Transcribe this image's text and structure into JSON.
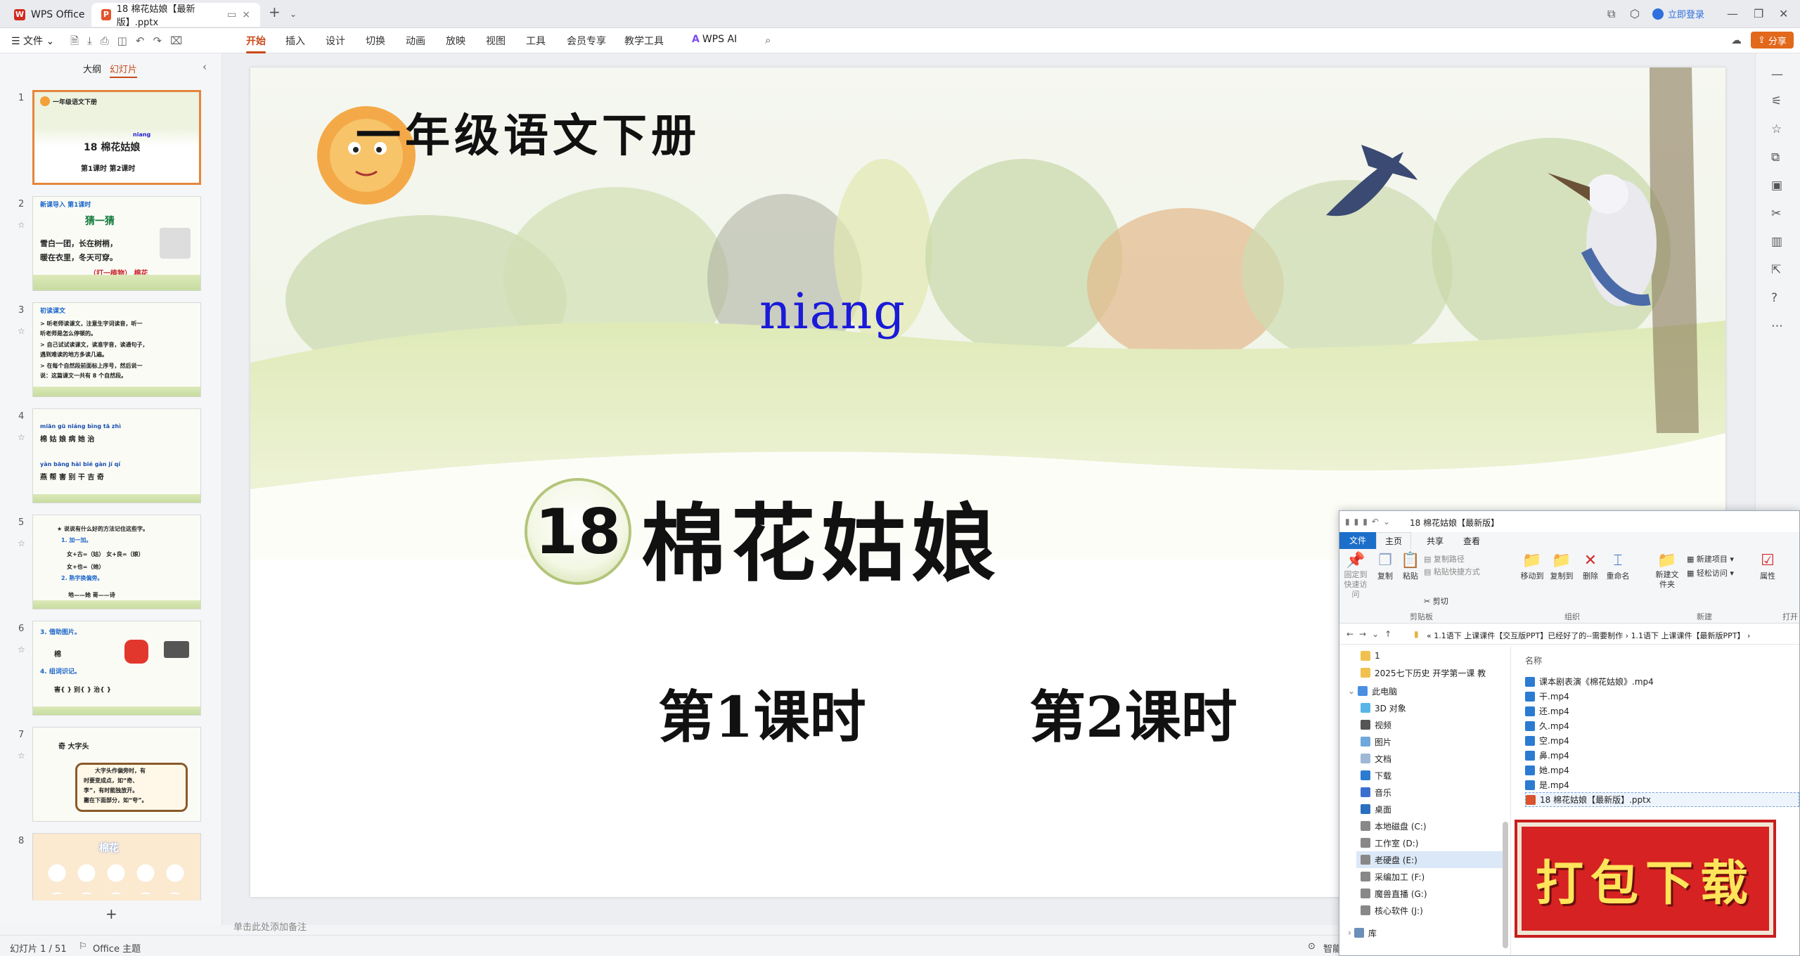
{
  "app": {
    "brand": "WPS Office",
    "doc_tab": "18 棉花姑娘【最新版】.pptx",
    "new_tab_symbol": "+",
    "login": "立即登录",
    "share": "分享"
  },
  "ribbon": {
    "file_menu": "文件",
    "tabs": [
      "开始",
      "插入",
      "设计",
      "切换",
      "动画",
      "放映",
      "视图",
      "工具",
      "会员专享",
      "教学工具"
    ],
    "wps_ai": "WPS AI"
  },
  "left_panel": {
    "outline_tab": "大纲",
    "slides_tab": "幻灯片",
    "add_slide": "+"
  },
  "thumbnails": [
    {
      "num": "1",
      "lines": [
        "一年级语文下册",
        "niang",
        "18 棉花姑娘",
        "第1课时    第2课时"
      ]
    },
    {
      "num": "2",
      "lines": [
        "新课导入        第1课时",
        "猜一猜",
        "雪白一团，长在树梢，",
        "暖在衣里，冬天可穿。",
        "（打一植物）   棉花"
      ]
    },
    {
      "num": "3",
      "lines": [
        "初读课文",
        "> 听老师读课文，注意生字词读音，听一",
        "  听老师是怎么停顿的。",
        "> 自己试试读课文，读准字音，读通句子，",
        "  遇到难读的地方多读几遍。",
        "> 在每个自然段前面标上序号，然后说一",
        "  说：这篇课文一共有 8 个自然段。"
      ]
    },
    {
      "num": "4",
      "lines": [
        "miān  gū  niáng  bìng  tā  zhì",
        "棉  姑  娘  病  她  治",
        "yàn  bāng  hài  bié  gàn  jí  qí",
        "燕  帮  害  别  干  吉  奇"
      ]
    },
    {
      "num": "5",
      "lines": [
        "★ 说说有什么好的方法记住这些字。",
        "1. 加一加。",
        "女+古=（姑）  女+良=（娘）",
        "女+也=（她）",
        "2. 熟字换偏旁。",
        "地——她   哥——诗"
      ]
    },
    {
      "num": "6",
      "lines": [
        "3. 借助图片。",
        "棉",
        "4. 组词识记。",
        "害{    } 别{    } 治{    }"
      ]
    },
    {
      "num": "7",
      "lines": [
        "奇   大字头",
        "大字头作偏旁时，有",
        "时要变成点，如“奇、",
        "李”，有时能独放开。",
        "撇在下面部分，如“夸”。"
      ]
    },
    {
      "num": "8",
      "lines": [
        "棉花"
      ]
    }
  ],
  "slide": {
    "header": "一年级语文下册",
    "lesson_number": "18",
    "pinyin": "niang",
    "title": "棉花姑娘",
    "period1": "第1课时",
    "period2": "第2课时"
  },
  "notes_placeholder": "单击此处添加备注",
  "status": {
    "slide_counter": "幻灯片 1 / 51",
    "theme": "Office 主题",
    "smart": "智能"
  },
  "explorer": {
    "title": "18 棉花姑娘【最新版】",
    "tabs": [
      "文件",
      "主页",
      "共享",
      "查看"
    ],
    "ribbon_buttons": [
      "固定到快速访问",
      "复制",
      "粘贴",
      "复制路径",
      "粘贴快捷方式",
      "剪切",
      "移动到",
      "复制到",
      "删除",
      "重命名",
      "新建文件夹",
      "新建项目",
      "轻松访问",
      "属性",
      "打开"
    ],
    "groups": [
      "剪贴板",
      "组织",
      "新建",
      "打开"
    ],
    "address": [
      "1.1语下 上课课件【交互版PPT】已经好了的--需要制作",
      "1.1语下 上课课件【最新版PPT】"
    ],
    "quick_access": [
      "1",
      "2025七下历史 开学第一课 教"
    ],
    "nav": [
      "此电脑",
      "3D 对象",
      "视频",
      "图片",
      "文档",
      "下载",
      "音乐",
      "桌面",
      "本地磁盘 (C:)",
      "工作室 (D:)",
      "老硬盘 (E:)",
      "采编加工 (F:)",
      "魔兽直播 (G:)",
      "核心软件 (J:)",
      "库"
    ],
    "column_header": "名称",
    "files": [
      "课本剧表演《棉花姑娘》.mp4",
      "干.mp4",
      "还.mp4",
      "久.mp4",
      "空.mp4",
      "鼻.mp4",
      "她.mp4",
      "是.mp4",
      "18 棉花姑娘【最新版】.pptx"
    ]
  },
  "banner": {
    "text": "打包下载"
  }
}
